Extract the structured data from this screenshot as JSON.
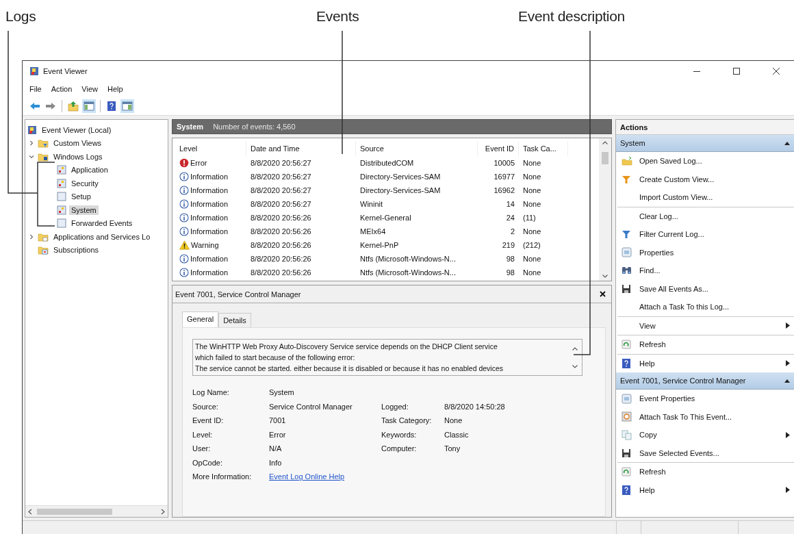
{
  "annotations": [
    {
      "label": "Logs"
    },
    {
      "label": "Events"
    },
    {
      "label": "Event description"
    }
  ],
  "window": {
    "title": "Event Viewer"
  },
  "menu": [
    "File",
    "Action",
    "View",
    "Help"
  ],
  "toolbar": [
    {
      "kind": "back",
      "pressed": false
    },
    {
      "kind": "forward",
      "pressed": false
    },
    {
      "kind": "separator",
      "pressed": false
    },
    {
      "kind": "up",
      "pressed": false
    },
    {
      "kind": "tree",
      "pressed": true
    },
    {
      "kind": "separator",
      "pressed": false
    },
    {
      "kind": "help",
      "pressed": false
    },
    {
      "kind": "pane",
      "pressed": true
    }
  ],
  "tree": {
    "label": "Event Viewer (Local)",
    "kind": "viewer",
    "selected": false,
    "children": [
      {
        "label": "Custom Views",
        "kind": "folder-filter",
        "expanded": false,
        "selected": false
      },
      {
        "label": "Windows Logs",
        "kind": "folder-log",
        "expanded": true,
        "selected": false,
        "children": [
          {
            "label": "Application",
            "kind": "log",
            "selected": false
          },
          {
            "label": "Security",
            "kind": "log",
            "selected": false
          },
          {
            "label": "Setup",
            "kind": "log-plain",
            "selected": false
          },
          {
            "label": "System",
            "kind": "log",
            "selected": true
          },
          {
            "label": "Forwarded Events",
            "kind": "log-plain",
            "selected": false
          }
        ]
      },
      {
        "label": "Applications and Services Lo",
        "kind": "folder-doc",
        "expanded": false,
        "selected": false
      },
      {
        "label": "Subscriptions",
        "kind": "subscriptions",
        "selected": false
      }
    ]
  },
  "events": {
    "log_name": "System",
    "count": "Number of events: 4,560",
    "columns": [
      "Level",
      "Date and Time",
      "Source",
      "Event ID",
      "Task Ca..."
    ],
    "rows": [
      {
        "kind": "error",
        "level": "Error",
        "date": "8/8/2020 20:56:27",
        "source": "DistributedCOM",
        "event_id": "10005",
        "task_category": "None"
      },
      {
        "kind": "information",
        "level": "Information",
        "date": "8/8/2020 20:56:27",
        "source": "Directory-Services-SAM",
        "event_id": "16977",
        "task_category": "None"
      },
      {
        "kind": "information",
        "level": "Information",
        "date": "8/8/2020 20:56:27",
        "source": "Directory-Services-SAM",
        "event_id": "16962",
        "task_category": "None"
      },
      {
        "kind": "information",
        "level": "Information",
        "date": "8/8/2020 20:56:27",
        "source": "Wininit",
        "event_id": "14",
        "task_category": "None"
      },
      {
        "kind": "information",
        "level": "Information",
        "date": "8/8/2020 20:56:26",
        "source": "Kernel-General",
        "event_id": "24",
        "task_category": "(11)"
      },
      {
        "kind": "information",
        "level": "Information",
        "date": "8/8/2020 20:56:26",
        "source": "MEIx64",
        "event_id": "2",
        "task_category": "None"
      },
      {
        "kind": "warning",
        "level": "Warning",
        "date": "8/8/2020 20:56:26",
        "source": "Kernel-PnP",
        "event_id": "219",
        "task_category": "(212)"
      },
      {
        "kind": "information",
        "level": "Information",
        "date": "8/8/2020 20:56:26",
        "source": "Ntfs (Microsoft-Windows-N...",
        "event_id": "98",
        "task_category": "None"
      },
      {
        "kind": "information",
        "level": "Information",
        "date": "8/8/2020 20:56:26",
        "source": "Ntfs (Microsoft-Windows-N...",
        "event_id": "98",
        "task_category": "None"
      }
    ]
  },
  "detail": {
    "title": "Event 7001, Service Control Manager",
    "tabs": [
      {
        "label": "General",
        "selected": true
      },
      {
        "label": "Details",
        "selected": false
      }
    ],
    "description": [
      "The WinHTTP Web Proxy Auto-Discovery Service service depends on the DHCP Client service",
      "which failed to start because of the following error:",
      "The service cannot be started. either because it is disabled or because it has no enabled devices"
    ],
    "rows": [
      [
        {
          "label": "Log Name:",
          "value": "System"
        }
      ],
      [
        {
          "label": "Source:",
          "value": "Service Control Manager"
        },
        {
          "label": "Logged:",
          "value": "8/8/2020 14:50:28"
        }
      ],
      [
        {
          "label": "Event ID:",
          "value": "7001"
        },
        {
          "label": "Task Category:",
          "value": "None"
        }
      ],
      [
        {
          "label": "Level:",
          "value": "Error"
        },
        {
          "label": "Keywords:",
          "value": "Classic"
        }
      ],
      [
        {
          "label": "User:",
          "value": "N/A"
        },
        {
          "label": "Computer:",
          "value": "Tony"
        }
      ],
      [
        {
          "label": "OpCode:",
          "value": "Info"
        }
      ]
    ],
    "more_info": {
      "label": "More Information:",
      "link": "Event Log Online Help"
    }
  },
  "actions": {
    "title": "Actions",
    "sections": [
      {
        "title": "System",
        "items": [
          {
            "label": "Open Saved Log...",
            "kind": "open",
            "submenu": false,
            "divider_after": false
          },
          {
            "label": "Create Custom View...",
            "kind": "filter-orange",
            "submenu": false,
            "divider_after": false
          },
          {
            "label": "Import Custom View...",
            "kind": "none",
            "submenu": false,
            "divider_after": true
          },
          {
            "label": "Clear Log...",
            "kind": "none",
            "submenu": false,
            "divider_after": false
          },
          {
            "label": "Filter Current Log...",
            "kind": "filter-blue",
            "submenu": false,
            "divider_after": false
          },
          {
            "label": "Properties",
            "kind": "properties",
            "submenu": false,
            "divider_after": false
          },
          {
            "label": "Find...",
            "kind": "find",
            "submenu": false,
            "divider_after": false
          },
          {
            "label": "Save All Events As...",
            "kind": "save",
            "submenu": false,
            "divider_after": false
          },
          {
            "label": "Attach a Task To this Log...",
            "kind": "none",
            "submenu": false,
            "divider_after": true
          },
          {
            "label": "View",
            "kind": "none",
            "submenu": true,
            "divider_after": true
          },
          {
            "label": "Refresh",
            "kind": "refresh",
            "submenu": false,
            "divider_after": true
          },
          {
            "label": "Help",
            "kind": "help",
            "submenu": true,
            "divider_after": false
          }
        ]
      },
      {
        "title": "Event 7001, Service Control Manager",
        "items": [
          {
            "label": "Event Properties",
            "kind": "properties",
            "submenu": false,
            "divider_after": false
          },
          {
            "label": "Attach Task To This Event...",
            "kind": "task",
            "submenu": false,
            "divider_after": false
          },
          {
            "label": "Copy",
            "kind": "copy",
            "submenu": true,
            "divider_after": false
          },
          {
            "label": "Save Selected Events...",
            "kind": "save",
            "submenu": false,
            "divider_after": true
          },
          {
            "label": "Refresh",
            "kind": "refresh",
            "submenu": false,
            "divider_after": false
          },
          {
            "label": "Help",
            "kind": "help",
            "submenu": true,
            "divider_after": false
          }
        ]
      }
    ]
  }
}
